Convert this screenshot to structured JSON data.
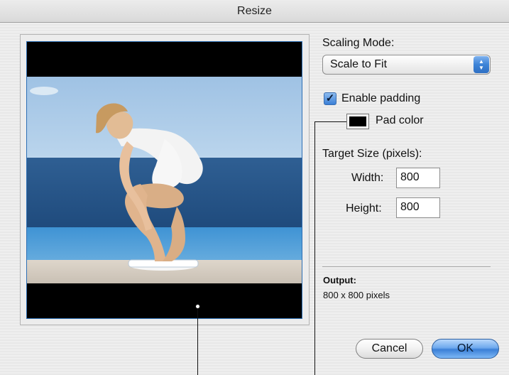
{
  "window": {
    "title": "Resize"
  },
  "preview": {
    "icon": "photo-image",
    "padding_color": "#000000"
  },
  "scaling": {
    "label": "Scaling Mode:",
    "selected": "Scale to Fit"
  },
  "padding": {
    "enable_label": "Enable padding",
    "checked": true,
    "pad_color_label": "Pad color",
    "pad_color": "#000000"
  },
  "target": {
    "title": "Target Size (pixels):",
    "width_label": "Width:",
    "width_value": "800",
    "height_label": "Height:",
    "height_value": "800"
  },
  "output": {
    "title": "Output:",
    "value": "800 x 800 pixels"
  },
  "buttons": {
    "cancel": "Cancel",
    "ok": "OK"
  }
}
